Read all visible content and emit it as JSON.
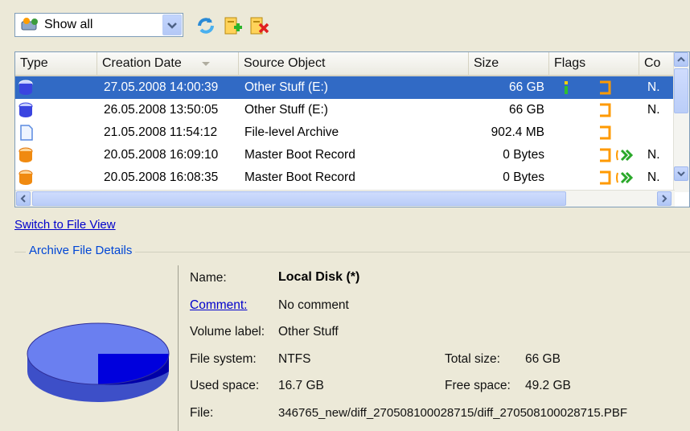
{
  "toolbar": {
    "filter_value": "Show all",
    "filter_icon": "network-drive-icon",
    "refresh_icon": "refresh-icon",
    "add_archive_icon": "add-archive-icon",
    "delete_archive_icon": "delete-archive-icon"
  },
  "list": {
    "columns": [
      "Type",
      "Creation Date",
      "Source Object",
      "Size",
      "Flags",
      "Co"
    ],
    "rows": [
      {
        "type_icon": "disk-backup-icon",
        "date": "27.05.2008 14:00:39",
        "source": "Other Stuff (E:)",
        "size": "66 GB",
        "co": "N."
      },
      {
        "type_icon": "disk-backup-icon",
        "date": "26.05.2008 13:50:05",
        "source": "Other Stuff (E:)",
        "size": "66 GB",
        "co": "N."
      },
      {
        "type_icon": "file-archive-icon",
        "date": "21.05.2008 11:54:12",
        "source": "File-level Archive",
        "size": "902.4 MB",
        "co": ""
      },
      {
        "type_icon": "mbr-backup-icon",
        "date": "20.05.2008 16:09:10",
        "source": "Master Boot Record",
        "size": "0 Bytes",
        "co": "N."
      },
      {
        "type_icon": "mbr-backup-icon",
        "date": "20.05.2008 16:08:35",
        "source": "Master Boot Record",
        "size": "0 Bytes",
        "co": "N."
      }
    ]
  },
  "switch_link": "Switch to File View",
  "details": {
    "group_title": "Archive File Details",
    "name_label": "Name:",
    "name_value": "Local Disk (*)",
    "comment_label": "Comment:",
    "comment_value": "No comment",
    "volume_label": "Volume label:",
    "volume_value": "Other Stuff",
    "fs_label": "File system:",
    "fs_value": "NTFS",
    "total_label": "Total size:",
    "total_value": "66 GB",
    "used_label": "Used space:",
    "used_value": "16.7 GB",
    "free_label": "Free space:",
    "free_value": "49.2 GB",
    "file_label": "File:",
    "file_value": "346765_new/diff_270508100028715/diff_270508100028715.PBF"
  },
  "colors": {
    "selection": "#316ac5",
    "pie_used": "#0000dd",
    "pie_free": "#6a7ff0"
  }
}
